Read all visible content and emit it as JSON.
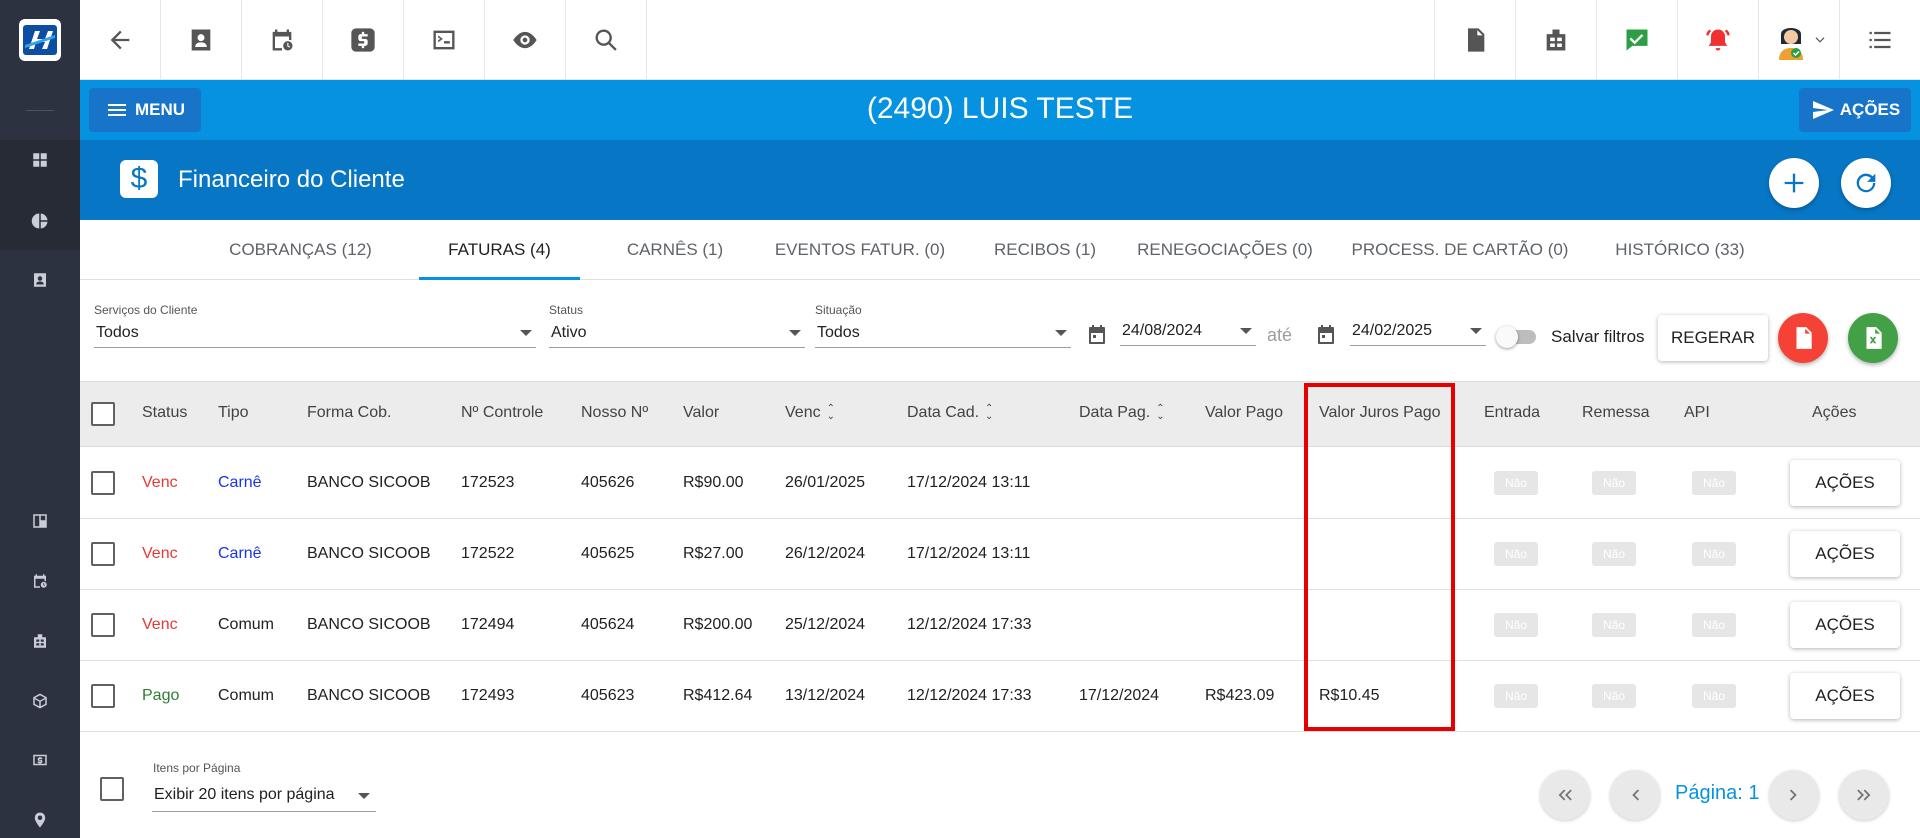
{
  "colors": {
    "sidebar_bg": "#2c323f",
    "titlebar_bg": "#0592e0",
    "section_bg": "#0776c5",
    "status_venc": "#e53935",
    "status_pago": "#2e7d32",
    "tipo_carne": "#1a35e8",
    "pdf_red": "#f44336",
    "excel_green": "#43a047",
    "highlight_red": "#e60000"
  },
  "toolbar": {
    "left_icons": [
      "back-arrow-icon",
      "contact-card-icon",
      "calendar-clock-icon",
      "dollar-icon",
      "terminal-icon",
      "eye-icon",
      "search-icon"
    ],
    "right_icons": [
      "pdf-icon",
      "building-icon",
      "check-chat-icon",
      "alarm-bell-icon",
      "user-avatar-icon",
      "list-menu-icon"
    ]
  },
  "header": {
    "menu_label": "MENU",
    "client_title": "(2490) LUIS TESTE",
    "acoes_label": "AÇÕES"
  },
  "section": {
    "icon": "$",
    "title": "Financeiro do Cliente"
  },
  "tabs": [
    {
      "label": "COBRANÇAS (12)",
      "active": false
    },
    {
      "label": "FATURAS (4)",
      "active": true
    },
    {
      "label": "CARNÊS (1)",
      "active": false
    },
    {
      "label": "EVENTOS FATUR. (0)",
      "active": false
    },
    {
      "label": "RECIBOS (1)",
      "active": false
    },
    {
      "label": "RENEGOCIAÇÕES (0)",
      "active": false
    },
    {
      "label": "PROCESS. DE CARTÃO (0)",
      "active": false
    },
    {
      "label": "HISTÓRICO (33)",
      "active": false
    }
  ],
  "filters": {
    "servicos_label": "Serviços do Cliente",
    "servicos_value": "Todos",
    "status_label": "Status",
    "status_value": "Ativo",
    "situacao_label": "Situação",
    "situacao_value": "Todos",
    "date_from": "24/08/2024",
    "ate_label": "até",
    "date_to": "24/02/2025",
    "salvar_filtros_label": "Salvar filtros",
    "salvar_filtros_on": false,
    "regerar_label": "REGERAR"
  },
  "table": {
    "columns": [
      "Status",
      "Tipo",
      "Forma Cob.",
      "Nº Controle",
      "Nosso Nº",
      "Valor",
      "Venc",
      "Data Cad.",
      "Data Pag.",
      "Valor Pago",
      "Valor Juros Pago",
      "Entrada",
      "Remessa",
      "API",
      "Ações"
    ],
    "rows": [
      {
        "status": "Venc",
        "tipo": "Carnê",
        "forma": "BANCO SICOOB",
        "controle": "172523",
        "nosso": "405626",
        "valor": "R$90.00",
        "venc": "26/01/2025",
        "data_cad": "17/12/2024 13:11",
        "data_pag": "",
        "valor_pago": "",
        "juros": "",
        "entrada": "Não",
        "remessa": "Não",
        "api": "Não",
        "acoes": "AÇÕES"
      },
      {
        "status": "Venc",
        "tipo": "Carnê",
        "forma": "BANCO SICOOB",
        "controle": "172522",
        "nosso": "405625",
        "valor": "R$27.00",
        "venc": "26/12/2024",
        "data_cad": "17/12/2024 13:11",
        "data_pag": "",
        "valor_pago": "",
        "juros": "",
        "entrada": "Não",
        "remessa": "Não",
        "api": "Não",
        "acoes": "AÇÕES"
      },
      {
        "status": "Venc",
        "tipo": "Comum",
        "forma": "BANCO SICOOB",
        "controle": "172494",
        "nosso": "405624",
        "valor": "R$200.00",
        "venc": "25/12/2024",
        "data_cad": "12/12/2024 17:33",
        "data_pag": "",
        "valor_pago": "",
        "juros": "",
        "entrada": "Não",
        "remessa": "Não",
        "api": "Não",
        "acoes": "AÇÕES"
      },
      {
        "status": "Pago",
        "tipo": "Comum",
        "forma": "BANCO SICOOB",
        "controle": "172493",
        "nosso": "405623",
        "valor": "R$412.64",
        "venc": "13/12/2024",
        "data_cad": "12/12/2024 17:33",
        "data_pag": "17/12/2024",
        "valor_pago": "R$423.09",
        "juros": "R$10.45",
        "entrada": "Não",
        "remessa": "Não",
        "api": "Não",
        "acoes": "AÇÕES"
      }
    ]
  },
  "footer": {
    "items_per_page_label": "Itens por Página",
    "items_per_page_value": "Exibir 20 itens por página",
    "page_label": "Página: 1"
  }
}
